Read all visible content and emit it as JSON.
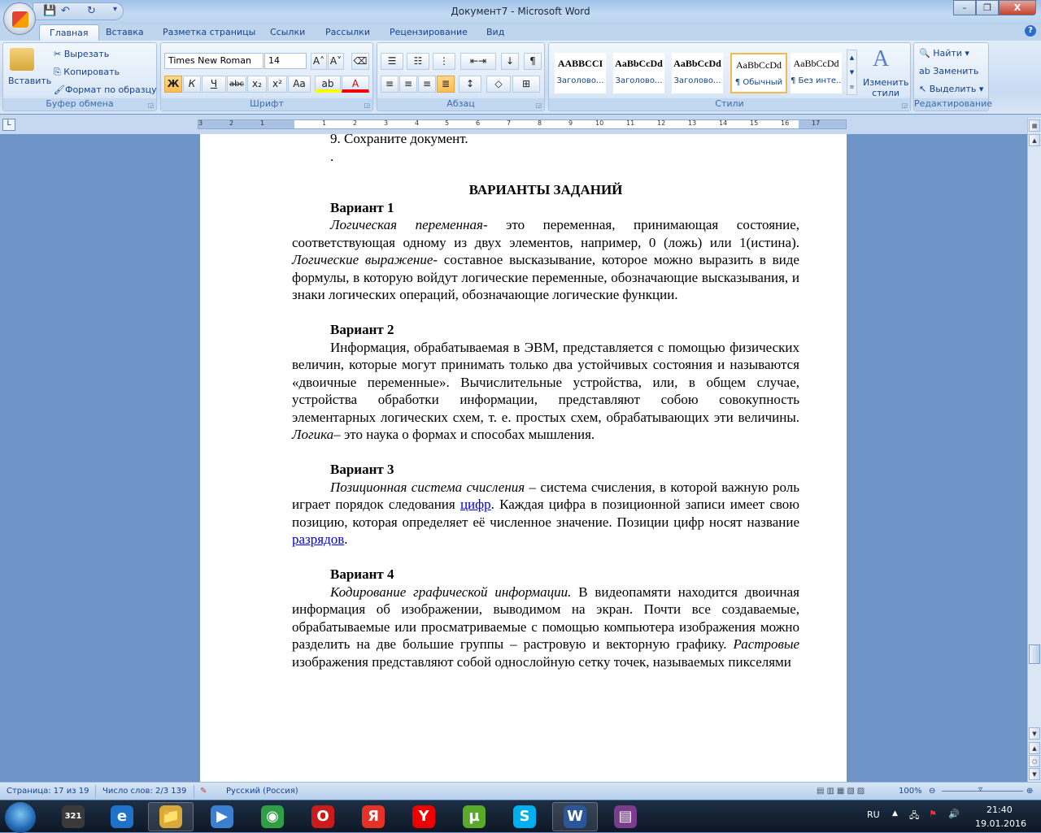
{
  "window": {
    "title": "Документ7 - Microsoft Word",
    "minimize": "–",
    "maximize": "❐",
    "close": "X"
  },
  "qat": {
    "save": "💾",
    "undo": "↶",
    "redo": "↻",
    "more": "▾"
  },
  "tabs": [
    "Главная",
    "Вставка",
    "Разметка страницы",
    "Ссылки",
    "Рассылки",
    "Рецензирование",
    "Вид"
  ],
  "help": "?",
  "clipboard": {
    "paste": "Вставить",
    "cut": "Вырезать",
    "copy": "Копировать",
    "format_painter": "Формат по образцу",
    "label": "Буфер обмена"
  },
  "font": {
    "name": "Times New Roman",
    "size": "14",
    "label": "Шрифт",
    "bold": "Ж",
    "italic": "К",
    "underline": "Ч",
    "strike": "abc",
    "sub": "x₂",
    "sup": "x²",
    "case": "Aa",
    "grow": "A˄",
    "shrink": "A˅"
  },
  "paragraph": {
    "label": "Абзац",
    "pilcrow": "¶"
  },
  "styles": {
    "label": "Стили",
    "items": [
      {
        "sample": "AABBCCI",
        "name": "Заголово..."
      },
      {
        "sample": "AaBbCcDd",
        "name": "Заголово..."
      },
      {
        "sample": "AaBbCcDd",
        "name": "Заголово..."
      },
      {
        "sample": "AaBbCcDd",
        "name": "¶ Обычный"
      },
      {
        "sample": "AaBbCcDd",
        "name": "¶ Без инте..."
      }
    ],
    "change": "Изменить стили"
  },
  "editing": {
    "label": "Редактирование",
    "find": "Найти",
    "replace": "Заменить",
    "select": "Выделить"
  },
  "ruler": {
    "numbers": [
      "3",
      "2",
      "1",
      "1",
      "2",
      "3",
      "4",
      "5",
      "6",
      "7",
      "8",
      "9",
      "10",
      "11",
      "12",
      "13",
      "14",
      "15",
      "16",
      "17"
    ]
  },
  "document": {
    "prev_line": "9. Сохраните документ.",
    "dot": ".",
    "heading": "ВАРИАНТЫ ЗАДАНИЙ",
    "v1": {
      "title": "Вариант  1",
      "i1": "Логическая переменная",
      "t1": "- это переменная, принимающая состояние, соответствующая одному из двух элементов, например, 0 (ложь) или 1(истина). ",
      "i2": "Логические выражение",
      "t2": "- составное высказывание, которое можно выразить в виде формулы, в которую войдут логические переменные, обозначающие высказывания, и знаки логических операций, обозначающие логические функции."
    },
    "v2": {
      "title": "Вариант  2",
      "t1": "Информация, обрабатываемая в ЭВМ, представляется с помощью физических величин, которые могут принимать только два устойчивых состояния и называются «двоичные переменные». Вычислительные устройства, или, в общем случае, устройства обработки информации, представляют собою совокупность элементарных логических схем, т. е. простых схем, обрабатывающих эти величины. ",
      "i1": "Логика",
      "t2": "– это наука о формах и способах мышления."
    },
    "v3": {
      "title": "Вариант 3",
      "i1": "Позиционная система счисления",
      "t1": " – система счисления, в которой важную роль играет порядок следования ",
      "link1": "цифр",
      "t2": ". Каждая цифра в позиционной записи имеет свою позицию, которая определяет её численное значение. Позиции цифр носят название ",
      "link2": "разрядов",
      "t3": "."
    },
    "v4": {
      "title": "Вариант  4",
      "i1": "Кодирование графической информации.",
      "t1": " В видеопамяти находится двоичная информация об изображении, выводимом на экран. Почти все создаваемые, обрабатываемые или просматриваемые с помощью компьютера изображения можно разделить на две большие группы – растровую и векторную графику. ",
      "i2": "Растровые",
      "t2": " изображения представляют собой однослойную сетку точек, называемых пикселями"
    }
  },
  "status": {
    "page": "Страница: 17 из 19",
    "words": "Число слов: 2/3 139",
    "language": "Русский (Россия)",
    "zoom": "100%"
  },
  "taskbar": {
    "lang": "RU",
    "time": "21:40",
    "date": "19.01.2016",
    "apps": [
      {
        "name": "media-player-classic",
        "glyph": "321",
        "color": "#3a3a3a"
      },
      {
        "name": "internet-explorer",
        "glyph": "e",
        "color": "#1e73c8"
      },
      {
        "name": "explorer",
        "glyph": "📁",
        "color": "#d9a93a"
      },
      {
        "name": "media-player",
        "glyph": "▶",
        "color": "#3a7fd0"
      },
      {
        "name": "chrome",
        "glyph": "◉",
        "color": "#2f9e44"
      },
      {
        "name": "opera",
        "glyph": "O",
        "color": "#cc1b1b"
      },
      {
        "name": "yandex-browser",
        "glyph": "Я",
        "color": "#e63127"
      },
      {
        "name": "yandex",
        "glyph": "Y",
        "color": "#e00"
      },
      {
        "name": "utorrent",
        "glyph": "µ",
        "color": "#5aa929"
      },
      {
        "name": "skype",
        "glyph": "S",
        "color": "#00aff0"
      },
      {
        "name": "word",
        "glyph": "W",
        "color": "#2b579a"
      },
      {
        "name": "winrar",
        "glyph": "▤",
        "color": "#7a3c8c"
      }
    ]
  }
}
